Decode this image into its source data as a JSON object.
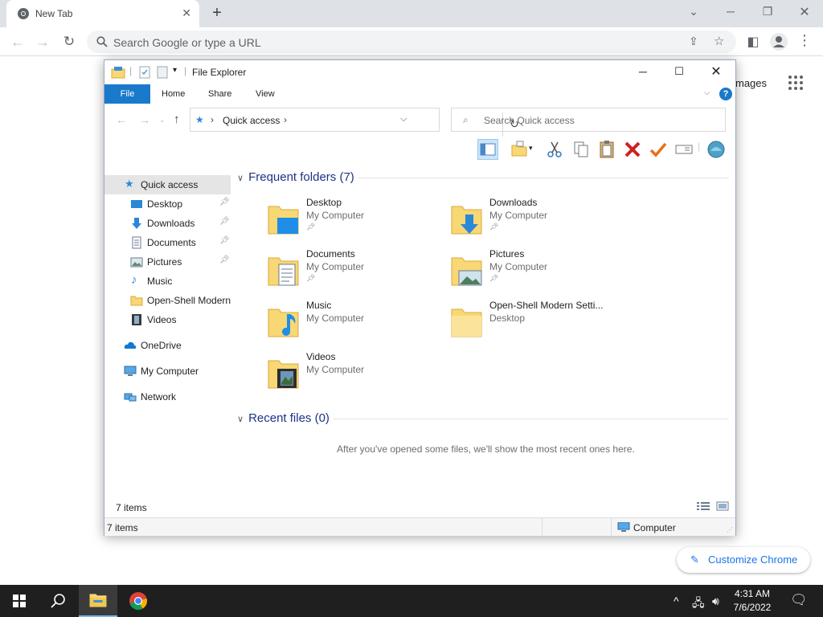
{
  "browser": {
    "tab_title": "New Tab",
    "omnibox_placeholder": "Search Google or type a URL",
    "ntp_images_link": "mages",
    "customize_label": "Customize Chrome"
  },
  "explorer": {
    "window_title": "File Explorer",
    "ribbon_tabs": {
      "file": "File",
      "home": "Home",
      "share": "Share",
      "view": "View"
    },
    "address_crumb": "Quick access",
    "search_placeholder": "Search Quick access",
    "nav": {
      "quick_access": "Quick access",
      "desktop": "Desktop",
      "downloads": "Downloads",
      "documents": "Documents",
      "pictures": "Pictures",
      "music": "Music",
      "open_shell": "Open-Shell Modern",
      "videos": "Videos",
      "onedrive": "OneDrive",
      "my_computer": "My Computer",
      "network": "Network"
    },
    "frequent_header": "Frequent folders (7)",
    "frequent_folders": [
      {
        "name": "Desktop",
        "location": "My Computer"
      },
      {
        "name": "Downloads",
        "location": "My Computer"
      },
      {
        "name": "Documents",
        "location": "My Computer"
      },
      {
        "name": "Pictures",
        "location": "My Computer"
      },
      {
        "name": "Music",
        "location": "My Computer"
      },
      {
        "name": "Open-Shell Modern Setti...",
        "location": "Desktop"
      },
      {
        "name": "Videos",
        "location": "My Computer"
      }
    ],
    "recent_header": "Recent files (0)",
    "recent_empty_message": "After you've opened some files, we'll show the most recent ones here.",
    "status_items": "7 items",
    "statusbar_items": "7 items",
    "statusbar_location": "Computer"
  },
  "taskbar": {
    "time": "4:31 AM",
    "date": "7/6/2022"
  },
  "colors": {
    "accent": "#1979ca",
    "folder_yellow": "#f8d775",
    "chrome_link": "#1a73e8",
    "taskbar_bg": "#1f1f1f"
  }
}
